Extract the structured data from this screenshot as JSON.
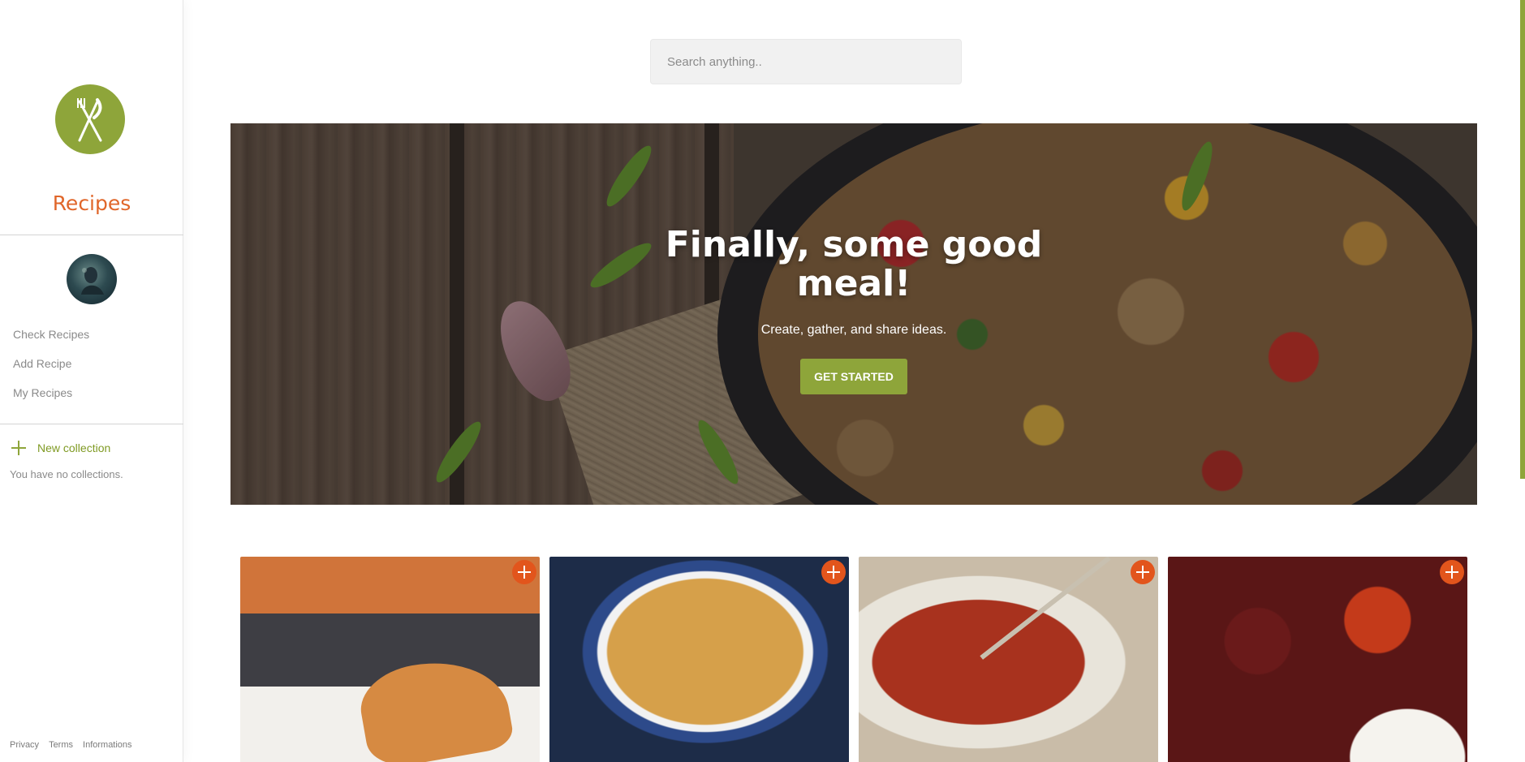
{
  "sidebar": {
    "brand": "Recipes",
    "nav": [
      "Check Recipes",
      "Add Recipe",
      "My Recipes"
    ],
    "new_collection": "New collection",
    "no_collections": "You have no collections.",
    "footer": [
      "Privacy",
      "Terms",
      "Informations"
    ]
  },
  "search": {
    "placeholder": "Search anything.."
  },
  "hero": {
    "title": "Finally, some good meal!",
    "subtitle": "Create, gather, and share ideas.",
    "button": "GET STARTED"
  },
  "colors": {
    "accent_green": "#8ea53a",
    "brand_orange": "#e0662a",
    "add_button": "#e2551c"
  },
  "icons": {
    "logo": "fork-knife-icon",
    "new_collection": "plus-icon",
    "card_add": "plus-icon"
  }
}
